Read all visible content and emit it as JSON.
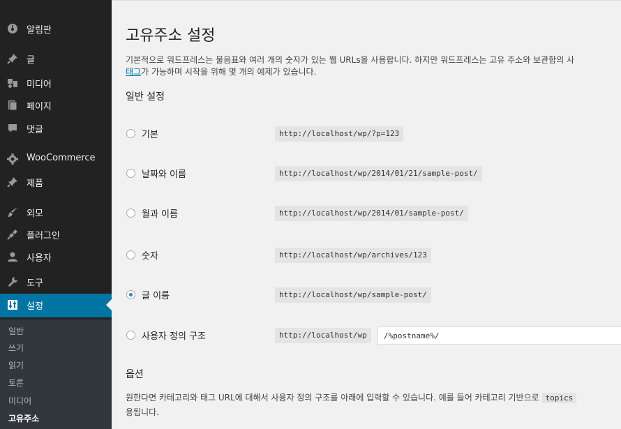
{
  "sidebar": {
    "items": [
      {
        "label": "알림판",
        "icon": "dashboard-icon"
      },
      {
        "label": "글",
        "icon": "pin-icon"
      },
      {
        "label": "미디어",
        "icon": "media-icon"
      },
      {
        "label": "페이지",
        "icon": "page-icon"
      },
      {
        "label": "댓글",
        "icon": "comment-icon"
      },
      {
        "label": "WooCommerce",
        "icon": "woocommerce-icon"
      },
      {
        "label": "제품",
        "icon": "pin-icon"
      },
      {
        "label": "외모",
        "icon": "brush-icon"
      },
      {
        "label": "플러그인",
        "icon": "plugin-icon"
      },
      {
        "label": "사용자",
        "icon": "user-icon"
      },
      {
        "label": "도구",
        "icon": "wrench-icon"
      },
      {
        "label": "설정",
        "icon": "settings-icon",
        "active": true
      }
    ],
    "submenu": [
      "일반",
      "쓰기",
      "읽기",
      "토론",
      "미디어",
      "고유주소"
    ]
  },
  "page": {
    "title": "고유주소 설정",
    "intro_line1": "기본적으로 워드프레스는 물음표와 여러 개의 숫자가 있는 웹 URLs을 사용합니다. 하지만 워드프레스는 고유 주소와 보관함의 사",
    "intro_link": "태그",
    "intro_line2": "가 가능하며 시작을 위해 몇 개의 예제가 있습니다.",
    "common_title": "일반 설정",
    "options": [
      {
        "label": "기본",
        "url": "http://localhost/wp/?p=123",
        "checked": false
      },
      {
        "label": "날짜와 이름",
        "url": "http://localhost/wp/2014/01/21/sample-post/",
        "checked": false
      },
      {
        "label": "월과 이름",
        "url": "http://localhost/wp/2014/01/sample-post/",
        "checked": false
      },
      {
        "label": "숫자",
        "url": "http://localhost/wp/archives/123",
        "checked": false
      },
      {
        "label": "글 이름",
        "url": "http://localhost/wp/sample-post/",
        "checked": true
      }
    ],
    "custom": {
      "label": "사용자 정의 구조",
      "prefix": "http://localhost/wp",
      "value": "/%postname%/"
    },
    "optional_title": "옵션",
    "optional_text1": "원한다면 카테고리와 태그 URL에 대해서 사용자 정의 구조를 아래에 입력할 수 있습니다. 예를 들어 카테고리 기반으로",
    "optional_code": "topics",
    "optional_text2": "용됩니다."
  },
  "colors": {
    "sidebar_bg": "#222222",
    "active_bg": "#0074a2",
    "link": "#0074a2"
  }
}
